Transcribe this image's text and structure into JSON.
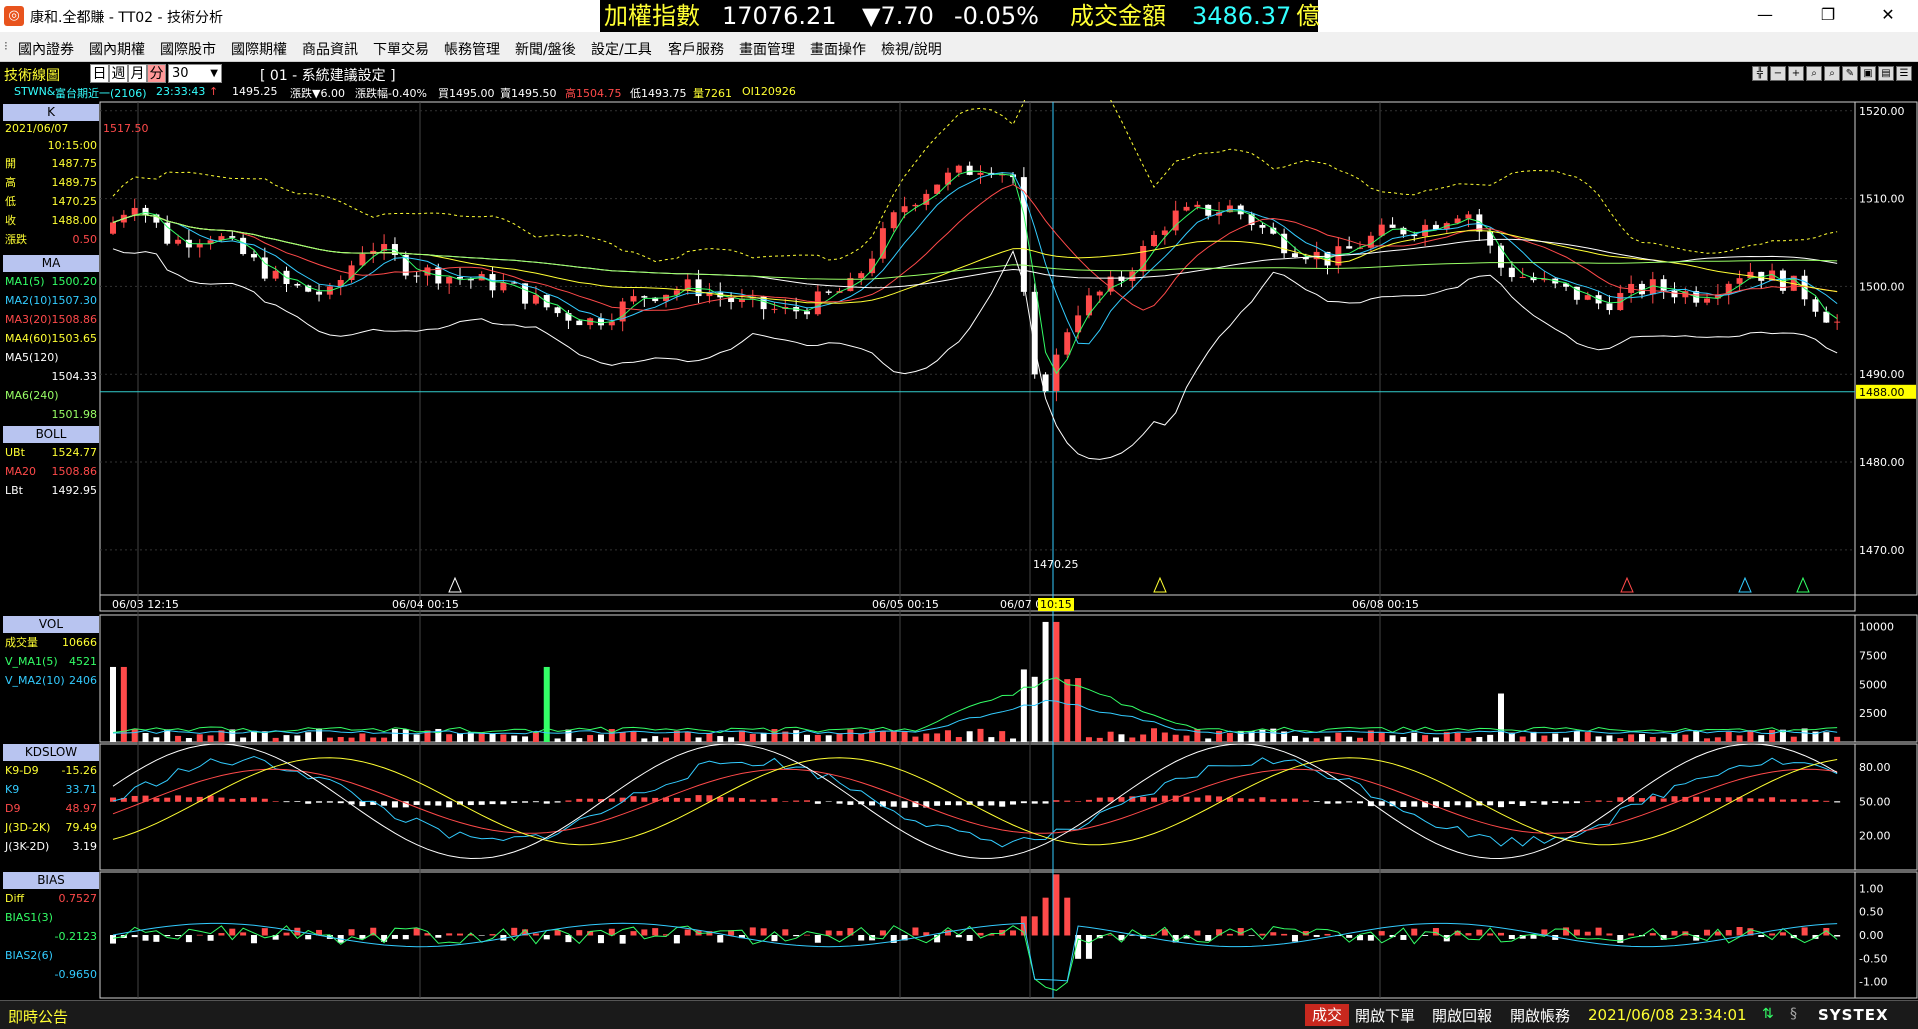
{
  "titlebar": {
    "title": "康和.全都賺 - TT02 - 技術分析",
    "index_label": "加權指數",
    "index_value": "17076.21",
    "index_change": "▼7.70",
    "index_pct": "-0.05%",
    "volume_label": "成交金額",
    "volume_value": "3486.37",
    "volume_unit": "億",
    "minimize": "—",
    "restore": "❐",
    "close": "✕"
  },
  "menu": [
    "國內證券",
    "國內期權",
    "國際股市",
    "國際期權",
    "商品資訊",
    "下單交易",
    "帳務管理",
    "新聞/盤後",
    "設定/工具",
    "客戶服務",
    "畫面管理",
    "畫面操作",
    "檢視/說明"
  ],
  "toolbar": {
    "panel_title": "技術線圖",
    "periods": [
      "日",
      "週",
      "月",
      "分"
    ],
    "active_period": "分",
    "interval": "30",
    "setting": "[ 01 - 系統建議設定 ]"
  },
  "quote": {
    "symbol": "STWN&",
    "name": "富台期近一(2106)",
    "time": "23:33:43",
    "arrow": "↑",
    "price": "1495.25",
    "change": "漲跌▼6.00",
    "pct": "漲跌幅-0.40%",
    "buy": "買1495.00",
    "sell": "賣1495.50",
    "high": "高1504.75",
    "low": "低1493.75",
    "vol": "量7261",
    "oi": "OI120926"
  },
  "legend": {
    "k": {
      "head": "K",
      "date": "2021/06/07",
      "time": "10:15:00",
      "rows": [
        [
          "開",
          "1487.75"
        ],
        [
          "高",
          "1489.75"
        ],
        [
          "低",
          "1470.25"
        ],
        [
          "收",
          "1488.00"
        ],
        [
          "漲跌",
          "0.50"
        ]
      ]
    },
    "ma": {
      "head": "MA",
      "rows": [
        [
          "MA1(5)",
          "1500.20"
        ],
        [
          "MA2(10)",
          "1507.30"
        ],
        [
          "MA3(20)",
          "1508.86"
        ],
        [
          "MA4(60)",
          "1503.65"
        ],
        [
          "MA5(120)",
          ""
        ],
        [
          "",
          "1504.33"
        ],
        [
          "MA6(240)",
          ""
        ],
        [
          "",
          "1501.98"
        ]
      ]
    },
    "boll": {
      "head": "BOLL",
      "rows": [
        [
          "UBt",
          "1524.77"
        ],
        [
          "MA20",
          "1508.86"
        ],
        [
          "LBt",
          "1492.95"
        ]
      ]
    },
    "vol": {
      "head": "VOL",
      "rows": [
        [
          "成交量",
          "10666"
        ],
        [
          "V_MA1(5)",
          "4521"
        ],
        [
          "V_MA2(10)",
          "2406"
        ]
      ]
    },
    "kd": {
      "head": "KDSLOW",
      "rows": [
        [
          "K9-D9",
          "-15.26"
        ],
        [
          "K9",
          "33.71"
        ],
        [
          "D9",
          "48.97"
        ],
        [
          "J(3D-2K)",
          "79.49"
        ],
        [
          "J(3K-2D)",
          "3.19"
        ]
      ]
    },
    "bias": {
      "head": "BIAS",
      "rows": [
        [
          "Diff",
          "0.7527"
        ],
        [
          "BIAS1(3)",
          ""
        ],
        [
          "",
          "-0.2123"
        ],
        [
          "BIAS2(6)",
          ""
        ],
        [
          "",
          "-0.9650"
        ]
      ]
    }
  },
  "colors": {
    "up": "#ff4a4a",
    "down": "#ffffff",
    "accent": "#ffff33",
    "cursor": "#33ccff"
  },
  "chart_data": {
    "type": "candlestick",
    "y_ticks": [
      "1520.00",
      "1510.00",
      "1500.00",
      "1490.00",
      "1480.00",
      "1470.00"
    ],
    "current_price_label": "1488.00",
    "high_label": "1517.50",
    "low_label": "1470.25",
    "x_labels": [
      "06/03 12:15",
      "06/04 00:15",
      "06/05 00:15",
      "06/07 0",
      "10:15",
      "06/08 00:15"
    ],
    "vol_ticks": [
      "10000",
      "7500",
      "5000",
      "2500"
    ],
    "kd_ticks": [
      "80.00",
      "50.00",
      "20.00"
    ],
    "bias_ticks": [
      "1.00",
      "0.50",
      "0.00",
      "-0.50",
      "-1.00"
    ]
  },
  "statusbar": {
    "notice": "即時公告",
    "trade": "成交",
    "btn1": "開啟下單",
    "btn2": "開啟回報",
    "btn3": "開啟帳務",
    "datetime": "2021/06/08 23:34:01",
    "brand": "SYSTEX"
  }
}
